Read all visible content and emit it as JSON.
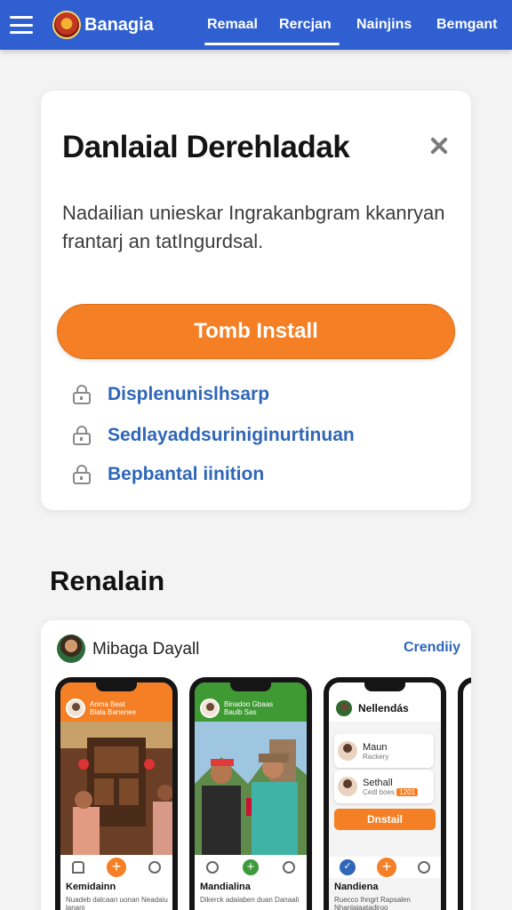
{
  "topbar": {
    "brand": "Banagia",
    "nav": [
      "Remaal",
      "Rercjan",
      "Nainjins",
      "Bemgant"
    ]
  },
  "install_card": {
    "title": "Danlaial Derehladak",
    "description": "Nadailian unieskar Ingrakanbgram kkanryan frantarj an tatIngurdsal.",
    "install_label": "Tomb Install",
    "features": [
      "Displenunislhsarp",
      "Sedlayaddsuriniginurtinuan",
      "Bepbantal iinition"
    ]
  },
  "section": {
    "title": "Renalain",
    "developer": "Mibaga Dayall",
    "link": "Crendiiy"
  },
  "screenshots": [
    {
      "header": "Anma Beat\nBlala Banenee",
      "caption_title": "Kemidainn",
      "caption_sub": "Nuadeb dalcaan uonan Neadaiu lanani"
    },
    {
      "header": "Binadoo Gbaas\nBaulb Sas",
      "caption_title": "Mandialina",
      "caption_sub": "Dikerck adalaben duan Danaali"
    },
    {
      "header": "Nellendás",
      "rows": [
        {
          "title": "Maun",
          "sub": "Rackery"
        },
        {
          "title": "Sethall",
          "sub": "Cedl boes",
          "badge": "1201"
        }
      ],
      "button": "Dnstail",
      "caption_title": "Nandiena",
      "caption_sub": "Ruecco Ihngrt Rapsalen Nhanlaiaatadiroo"
    }
  ],
  "colors": {
    "primary": "#2f5fd0",
    "accent": "#f57f24",
    "link": "#2f66b8"
  }
}
